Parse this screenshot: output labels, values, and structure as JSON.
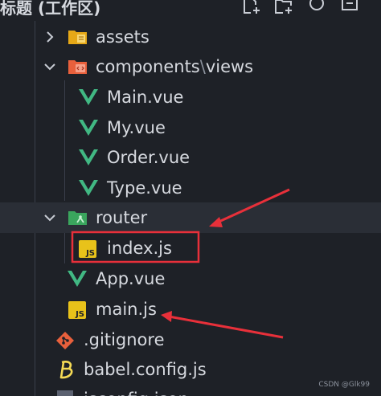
{
  "header": {
    "title": "标题 (工作区)",
    "actions": [
      {
        "icon": "new-file-icon"
      },
      {
        "icon": "new-folder-icon"
      },
      {
        "icon": "refresh-icon"
      },
      {
        "icon": "collapse-all-icon"
      }
    ]
  },
  "tree": {
    "assets": "assets",
    "components": "components",
    "components_sep": "\\",
    "views": "views",
    "main_vue": "Main.vue",
    "my_vue": "My.vue",
    "order_vue": "Order.vue",
    "type_vue": "Type.vue",
    "router": "router",
    "index_js": "index.js",
    "app_vue": "App.vue",
    "main_js": "main.js",
    "gitignore": ".gitignore",
    "babel_config": "babel.config.js",
    "next_item_partial": "jsconfig.json"
  },
  "badges": {
    "js": "JS"
  },
  "colors": {
    "background": "#1e2127",
    "vue_green": "#41b883",
    "js_yellow": "#e8c21a",
    "annotation_red": "#e8303a",
    "git_orange": "#e8603c",
    "babel_yellow": "#f5da55"
  },
  "watermark": "CSDN @Glk99"
}
